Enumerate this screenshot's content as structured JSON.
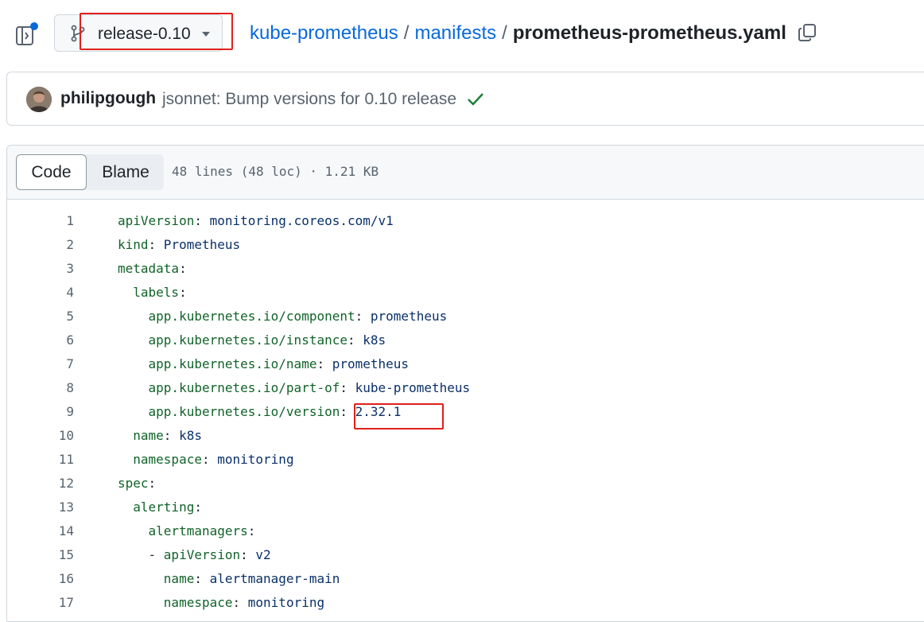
{
  "repo_nav": {
    "branch": "release-0.10",
    "breadcrumb": {
      "repo": "kube-prometheus",
      "sep1": "/",
      "folder": "manifests",
      "sep2": "/",
      "file": "prometheus-prometheus.yaml"
    }
  },
  "commit": {
    "author": "philipgough",
    "message": "jsonnet: Bump versions for 0.10 release",
    "status": "success"
  },
  "file_view": {
    "tabs": {
      "code": "Code",
      "blame": "Blame"
    },
    "meta": "48 lines (48 loc) · 1.21 KB",
    "lines": [
      {
        "n": "1",
        "indent": "",
        "key": "apiVersion",
        "colon": ":",
        "value": " monitoring.coreos.com/v1"
      },
      {
        "n": "2",
        "indent": "",
        "key": "kind",
        "colon": ":",
        "value": " Prometheus"
      },
      {
        "n": "3",
        "indent": "",
        "key": "metadata",
        "colon": ":",
        "value": ""
      },
      {
        "n": "4",
        "indent": "  ",
        "key": "labels",
        "colon": ":",
        "value": ""
      },
      {
        "n": "5",
        "indent": "    ",
        "key": "app.kubernetes.io/component",
        "colon": ":",
        "value": " prometheus"
      },
      {
        "n": "6",
        "indent": "    ",
        "key": "app.kubernetes.io/instance",
        "colon": ":",
        "value": " k8s"
      },
      {
        "n": "7",
        "indent": "    ",
        "key": "app.kubernetes.io/name",
        "colon": ":",
        "value": " prometheus"
      },
      {
        "n": "8",
        "indent": "    ",
        "key": "app.kubernetes.io/part-of",
        "colon": ":",
        "value": " kube-prometheus"
      },
      {
        "n": "9",
        "indent": "    ",
        "key": "app.kubernetes.io/version",
        "colon": ":",
        "value": " 2.32.1"
      },
      {
        "n": "10",
        "indent": "  ",
        "key": "name",
        "colon": ":",
        "value": " k8s"
      },
      {
        "n": "11",
        "indent": "  ",
        "key": "namespace",
        "colon": ":",
        "value": " monitoring"
      },
      {
        "n": "12",
        "indent": "",
        "key": "spec",
        "colon": ":",
        "value": ""
      },
      {
        "n": "13",
        "indent": "  ",
        "key": "alerting",
        "colon": ":",
        "value": ""
      },
      {
        "n": "14",
        "indent": "    ",
        "key": "alertmanagers",
        "colon": ":",
        "value": ""
      },
      {
        "n": "15",
        "indent": "    ",
        "dash": "- ",
        "key": "apiVersion",
        "colon": ":",
        "value": " v2",
        "valueClass": "v"
      },
      {
        "n": "16",
        "indent": "      ",
        "key": "name",
        "colon": ":",
        "value": " alertmanager-main"
      },
      {
        "n": "17",
        "indent": "      ",
        "key": "namespace",
        "colon": ":",
        "value": " monitoring"
      }
    ]
  },
  "colors": {
    "link": "#0969da",
    "highlight": "#e0201b",
    "yaml_key": "#116329",
    "yaml_value": "#0a3069",
    "success": "#1a7f37"
  },
  "icons": [
    "sidebar-toggle-icon",
    "git-branch-icon",
    "caret-down-icon",
    "copy-icon",
    "check-icon"
  ]
}
